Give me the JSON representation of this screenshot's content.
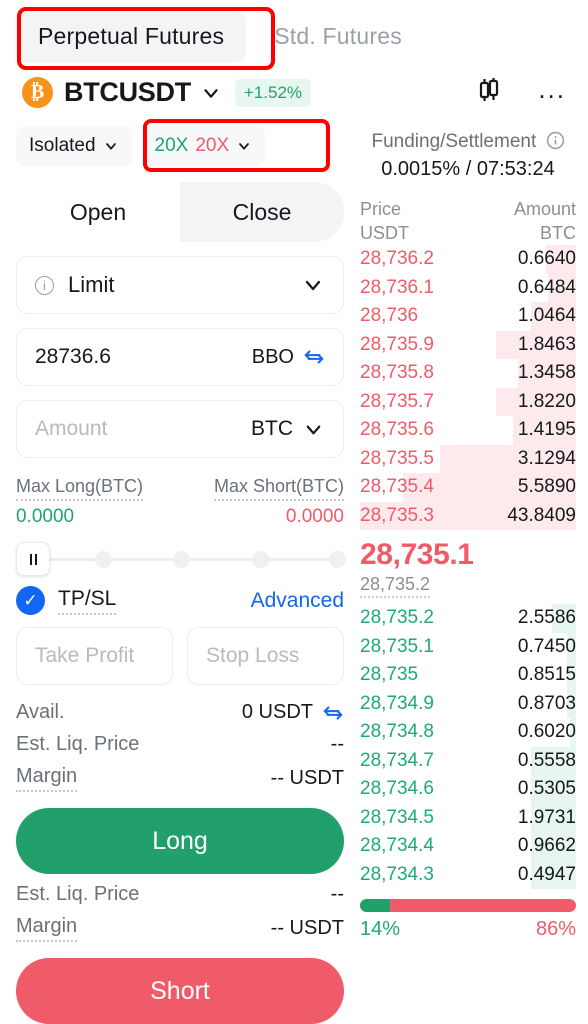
{
  "tabs": [
    {
      "label": "Perpetual Futures",
      "active": true
    },
    {
      "label": "Std. Futures",
      "active": false
    }
  ],
  "symbol": {
    "icon": "bitcoin-icon",
    "name": "BTCUSDT",
    "change": "+1.52%",
    "change_color": "#21a46c"
  },
  "header_icons": {
    "chart": "candlestick-icon",
    "more": "..."
  },
  "margin": {
    "mode": "Isolated",
    "leverage_long": "20X",
    "leverage_short": "20X"
  },
  "segmented": {
    "open": "Open",
    "close": "Close",
    "selected": "Open"
  },
  "order_form": {
    "type_label": "Limit",
    "price_value": "28736.6",
    "price_suffix": "BBO",
    "amount_placeholder": "Amount",
    "amount_unit": "BTC",
    "max_long_label": "Max Long(BTC)",
    "max_long_value": "0.0000",
    "max_short_label": "Max Short(BTC)",
    "max_short_value": "0.0000",
    "tpsl_label": "TP/SL",
    "tpsl_checked": true,
    "advanced_label": "Advanced",
    "take_profit_placeholder": "Take Profit",
    "stop_loss_placeholder": "Stop Loss"
  },
  "long_section": {
    "avail_label": "Avail.",
    "avail_value": "0 USDT",
    "liq_label": "Est. Liq. Price",
    "liq_value": "--",
    "margin_label": "Margin",
    "margin_value": "-- USDT",
    "button": "Long"
  },
  "short_section": {
    "liq_label": "Est. Liq. Price",
    "liq_value": "--",
    "margin_label": "Margin",
    "margin_value": "-- USDT",
    "button": "Short"
  },
  "orderbook": {
    "funding_label": "Funding/Settlement",
    "funding_value": "0.0015% / 07:53:24",
    "col_price": "Price",
    "col_price_unit": "USDT",
    "col_amount": "Amount",
    "col_amount_unit": "BTC",
    "mid_price": "28,735.1",
    "index_price": "28,735.2",
    "asks": [
      {
        "price": "28,736.2",
        "amount": "0.6640",
        "depth": 14
      },
      {
        "price": "28,736.1",
        "amount": "0.6484",
        "depth": 13
      },
      {
        "price": "28,736",
        "amount": "1.0464",
        "depth": 21
      },
      {
        "price": "28,735.9",
        "amount": "1.8463",
        "depth": 37
      },
      {
        "price": "28,735.8",
        "amount": "1.3458",
        "depth": 27
      },
      {
        "price": "28,735.7",
        "amount": "1.8220",
        "depth": 37
      },
      {
        "price": "28,735.6",
        "amount": "1.4195",
        "depth": 29
      },
      {
        "price": "28,735.5",
        "amount": "3.1294",
        "depth": 63
      },
      {
        "price": "28,735.4",
        "amount": "5.5890",
        "depth": 80
      },
      {
        "price": "28,735.3",
        "amount": "43.8409",
        "depth": 100
      }
    ],
    "bids": [
      {
        "price": "28,735.2",
        "amount": "2.5586",
        "depth": 11
      },
      {
        "price": "28,735.1",
        "amount": "0.7450",
        "depth": 4
      },
      {
        "price": "28,735",
        "amount": "0.8515",
        "depth": 4
      },
      {
        "price": "28,734.9",
        "amount": "0.8703",
        "depth": 4
      },
      {
        "price": "28,734.8",
        "amount": "0.6020",
        "depth": 3
      },
      {
        "price": "28,734.7",
        "amount": "0.5558",
        "depth": 21
      },
      {
        "price": "28,734.6",
        "amount": "0.5305",
        "depth": 21
      },
      {
        "price": "28,734.5",
        "amount": "1.9731",
        "depth": 21
      },
      {
        "price": "28,734.4",
        "amount": "0.9662",
        "depth": 21
      },
      {
        "price": "28,734.3",
        "amount": "0.4947",
        "depth": 21
      }
    ],
    "ratio_buy": "14%",
    "ratio_sell": "86%",
    "ratio_buy_pct": 14,
    "ratio_sell_pct": 86
  },
  "colors": {
    "green": "#22a06b",
    "red": "#ef5b68",
    "blue": "#1266f1",
    "bitcoin_orange": "#f7931a",
    "highlight": "#ff0000"
  }
}
